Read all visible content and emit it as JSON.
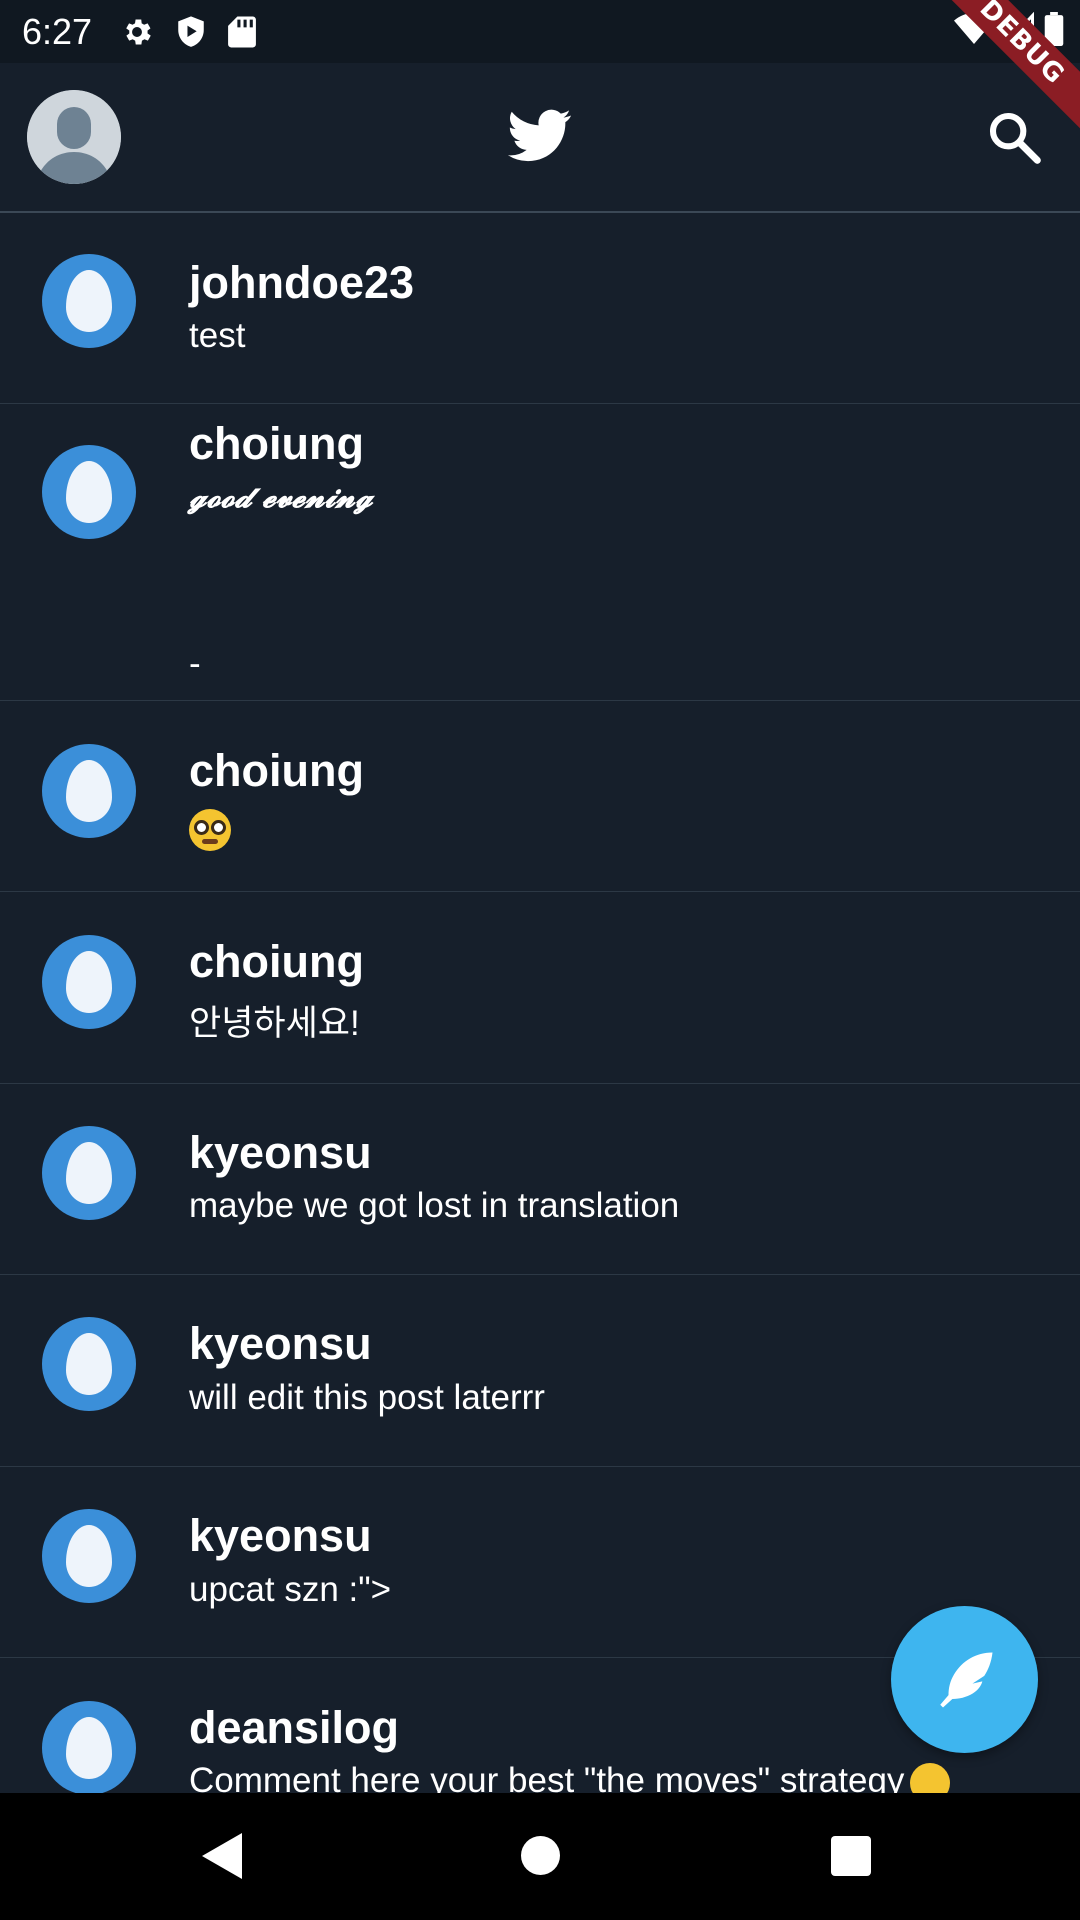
{
  "status_bar": {
    "time": "6:27",
    "icons": [
      "gear-icon",
      "shield-play-icon",
      "sd-card-icon"
    ],
    "right_icons": [
      "wifi-icon",
      "cell-signal-icon",
      "battery-icon"
    ],
    "debug_label": "DEBUG"
  },
  "app_bar": {
    "logo": "twitter-bird-icon",
    "search_icon": "search-icon",
    "avatar_icon": "default-profile-avatar"
  },
  "colors": {
    "background": "#161f2b",
    "status_bar": "#101821",
    "avatar_blue": "#3b8fd9",
    "fab": "#3eb5ef",
    "debug_ribbon": "#8b1d24"
  },
  "tweets": [
    {
      "username": "johndoe23",
      "content": "test"
    },
    {
      "username": "choiung",
      "content": "𝓰𝓸𝓸𝓭 𝓮𝓿𝓮𝓷𝓲𝓷𝓰",
      "extra": "-"
    },
    {
      "username": "choiung",
      "content": ""
    },
    {
      "username": "choiung",
      "content": "안녕하세요!"
    },
    {
      "username": "kyeonsu",
      "content": "maybe we got lost in translation"
    },
    {
      "username": "kyeonsu",
      "content": "will edit this post laterrr"
    },
    {
      "username": "kyeonsu",
      "content": "upcat szn :\">"
    },
    {
      "username": "deansilog",
      "content": "Comment here your best \"the moves\" strategy"
    }
  ],
  "fab": {
    "icon": "feather-compose-icon"
  },
  "nav_bar": {
    "icons": [
      "back-icon",
      "home-icon",
      "recents-icon"
    ]
  }
}
